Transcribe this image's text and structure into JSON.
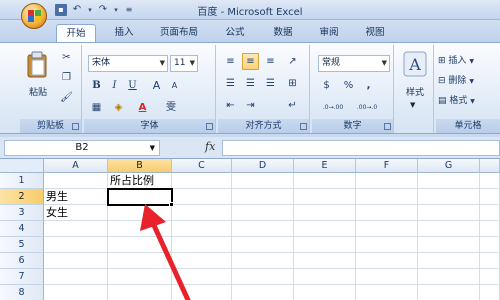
{
  "window": {
    "title": "百度 - Microsoft Excel"
  },
  "qat": {
    "icons": [
      "save-icon",
      "undo-icon",
      "redo-icon",
      "customize-icon"
    ]
  },
  "tabs": [
    "开始",
    "插入",
    "页面布局",
    "公式",
    "数据",
    "审阅",
    "视图"
  ],
  "active_tab": "开始",
  "ribbon": {
    "clipboard": {
      "paste_label": "粘贴",
      "group_label": "剪贴板"
    },
    "font": {
      "font_name": "宋体",
      "font_size": "11",
      "group_label": "字体",
      "bold": "B",
      "italic": "I",
      "underline": "U",
      "grow": "A",
      "shrink": "A",
      "font_color_letter": "A",
      "phonetic": "雯"
    },
    "alignment": {
      "group_label": "对齐方式"
    },
    "number": {
      "format": "常规",
      "currency": "$",
      "percent": "%",
      "comma": ",",
      "inc_decimal": ".0→.00",
      "dec_decimal": ".00→.0",
      "group_label": "数字"
    },
    "styles": {
      "label": "样式"
    },
    "cells": {
      "insert": "插入",
      "delete": "删除",
      "format": "格式",
      "group_label": "单元格"
    }
  },
  "formula_bar": {
    "name_box": "B2",
    "fx": "fx",
    "formula": ""
  },
  "sheet": {
    "columns": [
      "A",
      "B",
      "C",
      "D",
      "E",
      "F",
      "G"
    ],
    "active_column": "B",
    "rows": [
      "1",
      "2",
      "3",
      "4",
      "5",
      "6",
      "7",
      "8"
    ],
    "active_row": "2",
    "cells": {
      "B1": "所占比例",
      "A2": "男生",
      "A3": "女生"
    }
  },
  "colors": {
    "annotation_arrow": "#e8212b",
    "accent": "#f8cc6b"
  }
}
